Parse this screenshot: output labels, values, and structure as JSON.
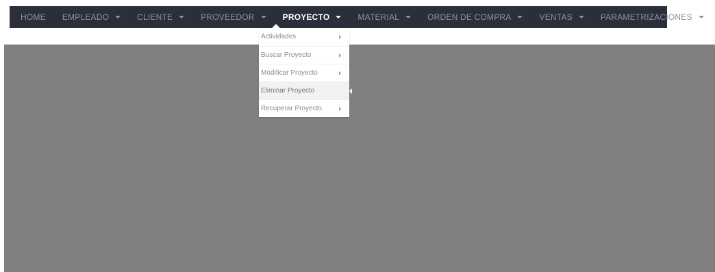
{
  "navbar": {
    "items": [
      {
        "label": "HOME",
        "has_caret": false,
        "active": false
      },
      {
        "label": "EMPLEADO",
        "has_caret": true,
        "active": false
      },
      {
        "label": "CLIENTE",
        "has_caret": true,
        "active": false
      },
      {
        "label": "PROVEEDOR",
        "has_caret": true,
        "active": false
      },
      {
        "label": "PROYECTO",
        "has_caret": true,
        "active": true
      },
      {
        "label": "MATERIAL",
        "has_caret": true,
        "active": false
      },
      {
        "label": "ORDEN DE COMPRA",
        "has_caret": true,
        "active": false
      },
      {
        "label": "VENTAS",
        "has_caret": true,
        "active": false
      },
      {
        "label": "PARAMETRIZACIONES",
        "has_caret": true,
        "active": false
      }
    ]
  },
  "dropdown": {
    "items": [
      {
        "label": "Actividades",
        "has_arrow": true
      },
      {
        "label": "Buscar Proyecto",
        "has_arrow": true
      },
      {
        "label": "Modificar Proyecto",
        "has_arrow": true
      },
      {
        "label": "Eliminar Proyecto",
        "has_arrow": false,
        "highlighted": true
      },
      {
        "label": "Recuperar Proyecto",
        "has_arrow": true
      }
    ]
  },
  "colors": {
    "navbar_bg": "#2a2f3a",
    "nav_text": "#8d919b",
    "nav_active_text": "#ffffff",
    "content_bg": "#808080"
  }
}
